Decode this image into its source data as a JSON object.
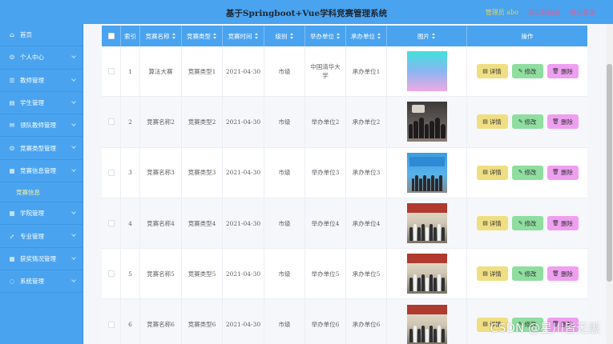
{
  "header": {
    "title": "基于Springboot+Vue学科竞赛管理系统",
    "admin_label": "管理员 abo",
    "back_label": "退出到前台",
    "logout_label": "退出登录"
  },
  "sidebar": {
    "items": [
      {
        "label": "首页",
        "icon": "home-icon",
        "has_arrow": false
      },
      {
        "label": "个人中心",
        "icon": "user-icon",
        "has_arrow": true
      },
      {
        "label": "教师管理",
        "icon": "list-icon",
        "has_arrow": true
      },
      {
        "label": "学生管理",
        "icon": "doc-icon",
        "has_arrow": true
      },
      {
        "label": "领队教师管理",
        "icon": "mail-icon",
        "has_arrow": true
      },
      {
        "label": "竞赛类型管理",
        "icon": "user-icon",
        "has_arrow": true
      },
      {
        "label": "竞赛信息管理",
        "icon": "grid-icon",
        "has_arrow": true,
        "sub": "竞赛信息"
      },
      {
        "label": "学院管理",
        "icon": "grid-icon",
        "has_arrow": true
      },
      {
        "label": "专业管理",
        "icon": "expand-icon",
        "has_arrow": true
      },
      {
        "label": "获奖情况管理",
        "icon": "grid-icon",
        "has_arrow": true
      },
      {
        "label": "系统管理",
        "icon": "circle-icon",
        "has_arrow": true
      }
    ]
  },
  "table": {
    "headers": {
      "index": "索引",
      "name": "竞赛名称",
      "type": "竞赛类型",
      "time": "竞赛时间",
      "level": "级别",
      "organizer": "举办单位",
      "coorganizer": "承办单位",
      "image": "图片",
      "actions": "操作"
    },
    "action_labels": {
      "detail": "详情",
      "edit": "修改",
      "delete": "删除"
    },
    "rows": [
      {
        "index": "1",
        "name": "算法大赛",
        "type": "竞赛类型1",
        "time": "2021-04-30",
        "level": "市级",
        "organizer": "中国清华大学",
        "coorganizer": "承办单位1",
        "image": "gradient"
      },
      {
        "index": "2",
        "name": "竞赛名称2",
        "type": "竞赛类型2",
        "time": "2021-04-30",
        "level": "市级",
        "organizer": "举办单位2",
        "coorganizer": "承办单位2",
        "image": "crowd"
      },
      {
        "index": "3",
        "name": "竞赛名称3",
        "type": "竞赛类型3",
        "time": "2021-04-30",
        "level": "市级",
        "organizer": "举办单位3",
        "coorganizer": "承办单位3",
        "image": "stage"
      },
      {
        "index": "4",
        "name": "竞赛名称4",
        "type": "竞赛类型4",
        "time": "2021-04-30",
        "level": "市级",
        "organizer": "举办单位4",
        "coorganizer": "承办单位4",
        "image": "outdoor"
      },
      {
        "index": "5",
        "name": "竞赛名称5",
        "type": "竞赛类型5",
        "time": "2021-04-30",
        "level": "市级",
        "organizer": "举办单位5",
        "coorganizer": "承办单位5",
        "image": "outdoor"
      },
      {
        "index": "6",
        "name": "竞赛名称6",
        "type": "竞赛类型6",
        "time": "2021-04-30",
        "level": "市级",
        "organizer": "举办单位6",
        "coorganizer": "承办单位6",
        "image": "outdoor"
      }
    ]
  },
  "watermark": "CSDN @星川皆无恙",
  "colors": {
    "primary": "#4aa3ef",
    "admin": "#e3d35c",
    "link": "#e55b8e",
    "detail_button": "#f0de83",
    "edit_button": "#8fdea0",
    "delete_button": "#ee9ff0"
  }
}
